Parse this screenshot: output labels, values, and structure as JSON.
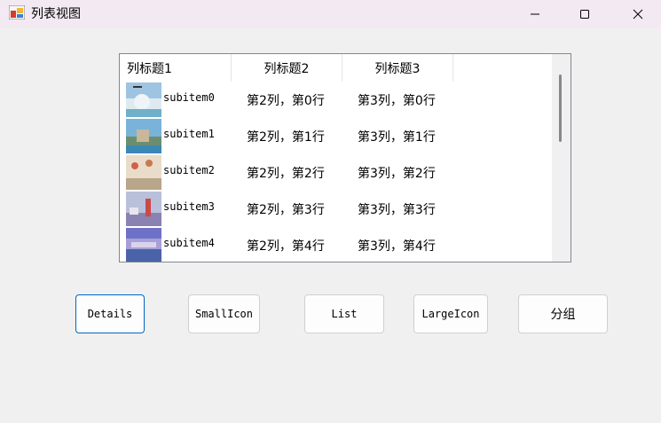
{
  "window": {
    "title": "列表视图",
    "controls": [
      "minimize",
      "maximize",
      "close"
    ]
  },
  "listview": {
    "columns": [
      "列标题1",
      "列标题2",
      "列标题3"
    ],
    "rows": [
      {
        "name": "subitem0",
        "col2": "第2列，第0行",
        "col3": "第3列，第0行",
        "thumb": "thumbnail-image"
      },
      {
        "name": "subitem1",
        "col2": "第2列，第1行",
        "col3": "第3列，第1行",
        "thumb": "thumbnail-image"
      },
      {
        "name": "subitem2",
        "col2": "第2列，第2行",
        "col3": "第3列，第2行",
        "thumb": "thumbnail-image"
      },
      {
        "name": "subitem3",
        "col2": "第2列，第3行",
        "col3": "第3列，第3行",
        "thumb": "thumbnail-image"
      },
      {
        "name": "subitem4",
        "col2": "第2列，第4行",
        "col3": "第3列，第4行",
        "thumb": "thumbnail-image"
      }
    ]
  },
  "buttons": {
    "details": "Details",
    "small_icon": "SmallIcon",
    "list": "List",
    "large_icon": "LargeIcon",
    "group": "分组"
  },
  "colors": {
    "titlebar_bg": "#f3e9f3",
    "window_bg": "#f0f0f0",
    "focus_border": "#0067c0"
  }
}
